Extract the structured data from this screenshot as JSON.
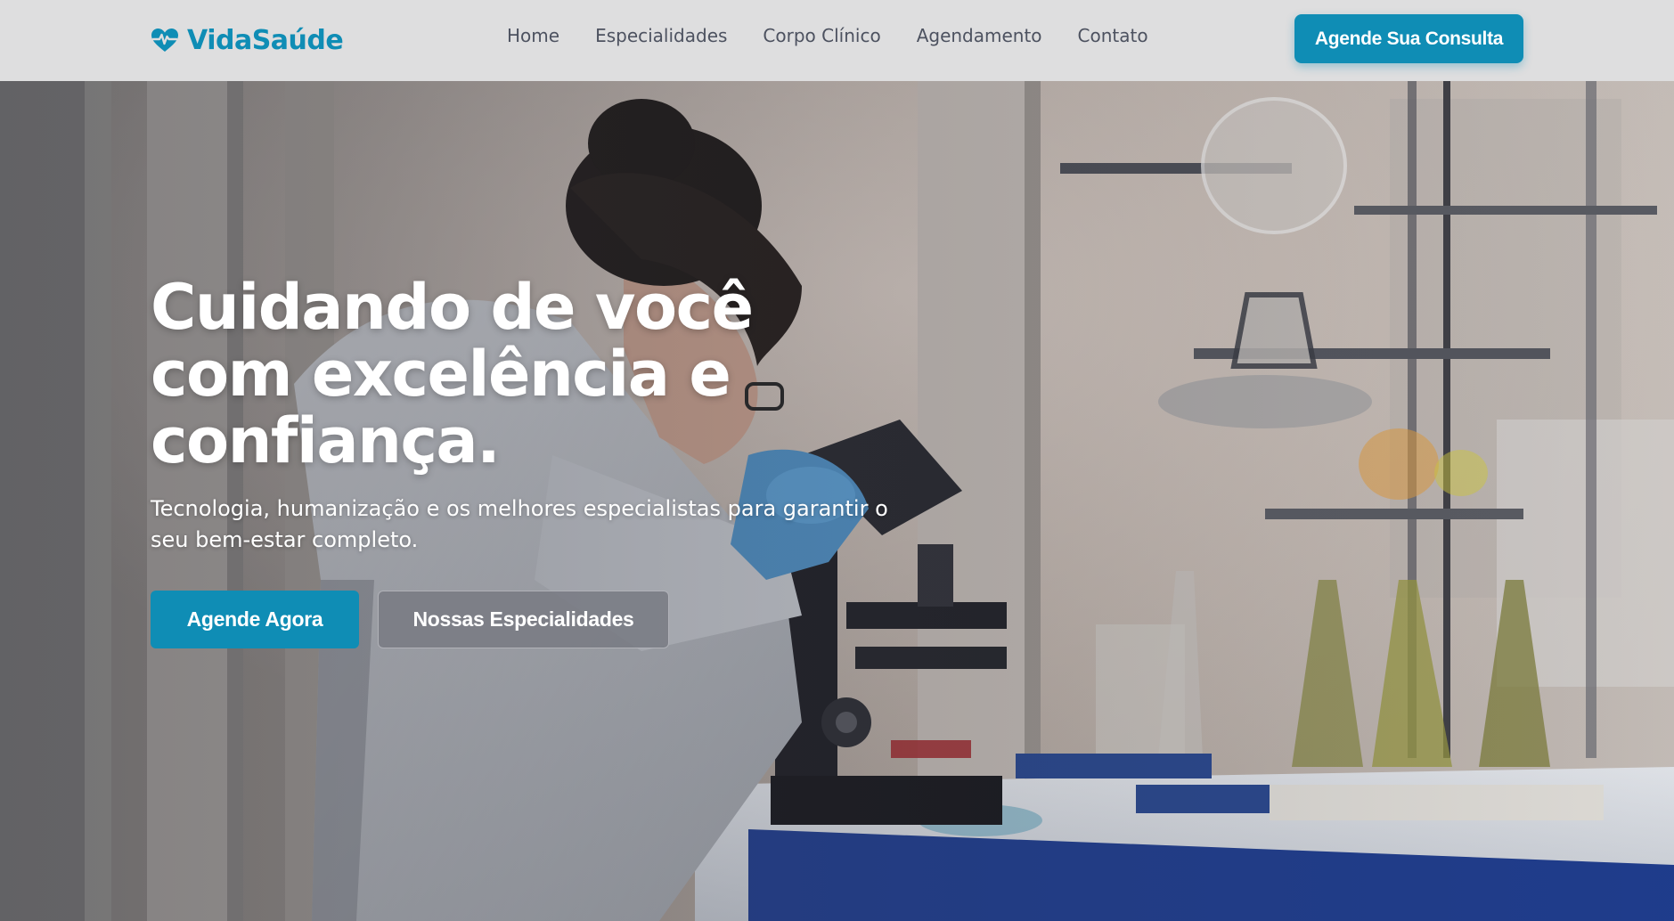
{
  "brand": {
    "name": "VidaSaúde",
    "logo_icon": "heart-pulse-icon",
    "color": "#0f8db5"
  },
  "nav": {
    "links": [
      {
        "label": "Home"
      },
      {
        "label": "Especialidades"
      },
      {
        "label": "Corpo Clínico"
      },
      {
        "label": "Agendamento"
      },
      {
        "label": "Contato"
      }
    ],
    "cta_label": "Agende Sua Consulta"
  },
  "hero": {
    "title": "Cuidando de você com excelência e confiança.",
    "subtitle": "Tecnologia, humanização e os melhores especialistas para garantir o seu bem-estar completo.",
    "primary_button": "Agende Agora",
    "secondary_button": "Nossas Especialidades",
    "background_image": "scientist-with-microscope-in-laboratory"
  },
  "colors": {
    "accent": "#0f8db5",
    "navbar_bg": "#dededf",
    "nav_text": "#4d5260"
  }
}
